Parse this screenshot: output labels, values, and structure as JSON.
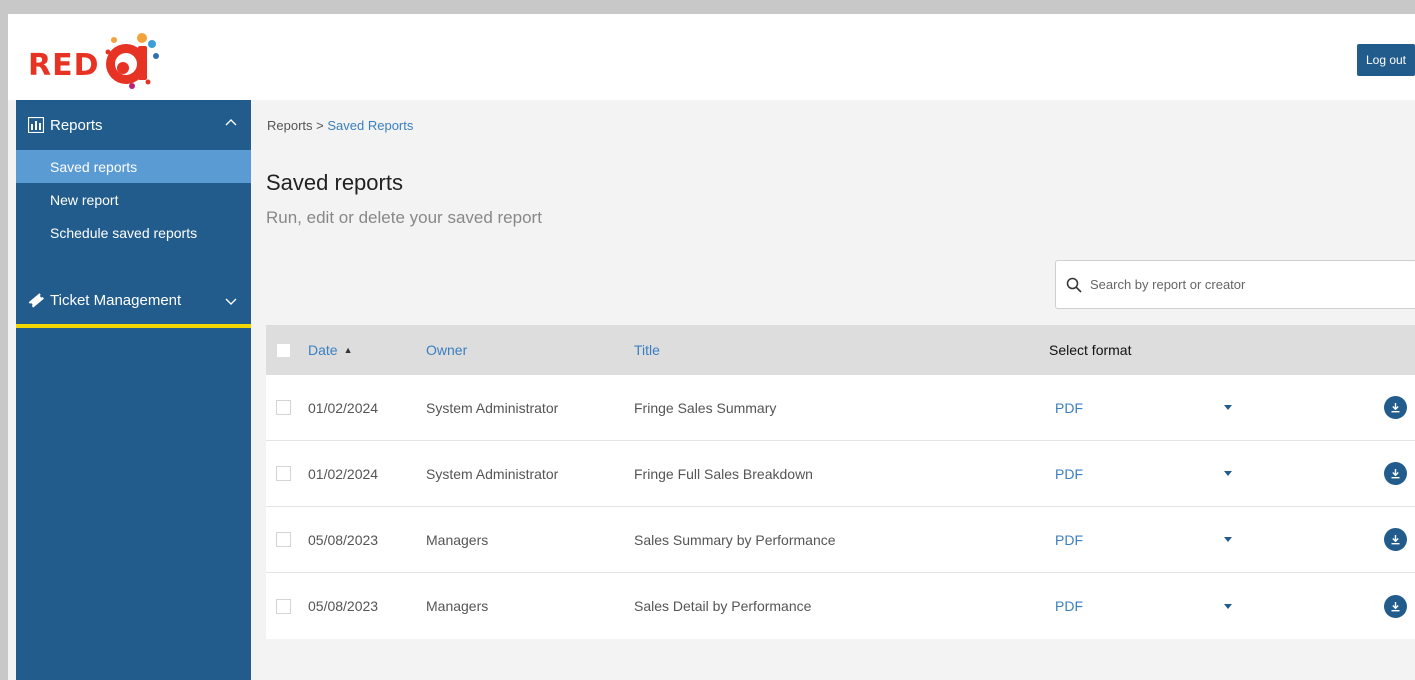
{
  "header": {
    "logo_text": "RED",
    "logout_label": "Log out"
  },
  "sidebar": {
    "reports_label": "Reports",
    "items": [
      {
        "label": "Saved reports"
      },
      {
        "label": "New report"
      },
      {
        "label": "Schedule saved reports"
      }
    ],
    "ticket_label": "Ticket Management"
  },
  "breadcrumb": {
    "root": "Reports",
    "separator": ">",
    "current": "Saved Reports"
  },
  "page": {
    "title": "Saved reports",
    "subtitle": "Run, edit or delete your saved report"
  },
  "search": {
    "placeholder": "Search by report or creator",
    "value": ""
  },
  "table": {
    "headers": {
      "date": "Date",
      "owner": "Owner",
      "title": "Title",
      "format": "Select format"
    },
    "rows": [
      {
        "date": "01/02/2024",
        "owner": "System Administrator",
        "title": "Fringe Sales Summary",
        "format": "PDF"
      },
      {
        "date": "01/02/2024",
        "owner": "System Administrator",
        "title": "Fringe Full Sales Breakdown",
        "format": "PDF"
      },
      {
        "date": "05/08/2023",
        "owner": "Managers",
        "title": "Sales Summary by Performance",
        "format": "PDF"
      },
      {
        "date": "05/08/2023",
        "owner": "Managers",
        "title": "Sales Detail by Performance",
        "format": "PDF"
      }
    ]
  },
  "colors": {
    "brand_blue": "#225c8d",
    "active_item": "#5a9bd4",
    "link_blue": "#3a7fc1",
    "logo_red": "#e63323",
    "highlight_yellow": "#f2d600"
  }
}
